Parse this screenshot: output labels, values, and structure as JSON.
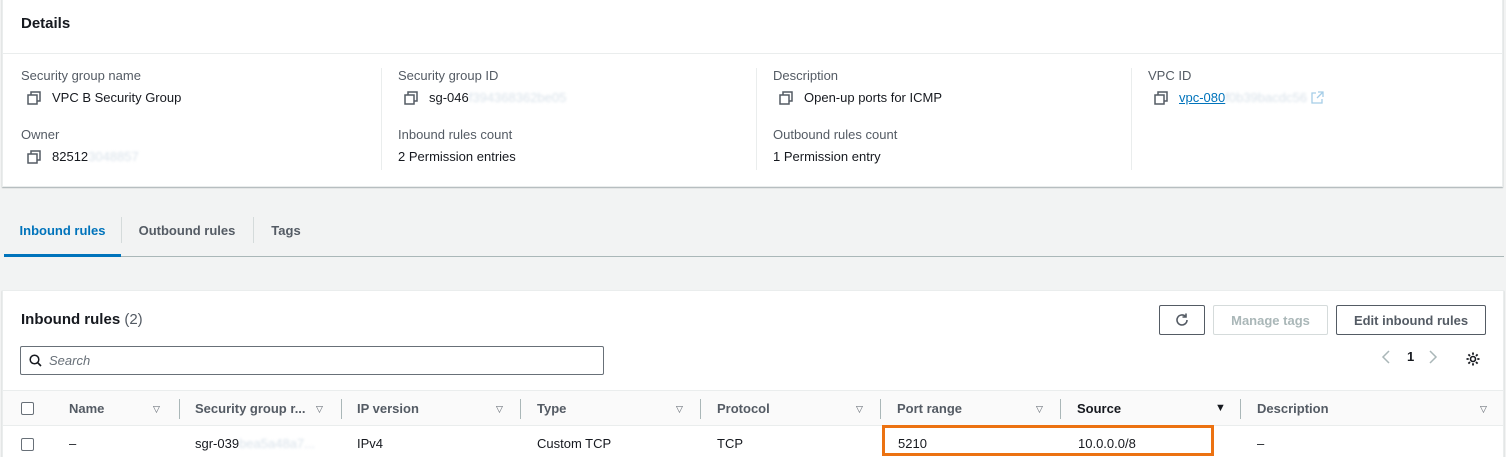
{
  "details": {
    "title": "Details",
    "security_group_name": {
      "label": "Security group name",
      "value": "VPC B Security Group"
    },
    "security_group_id": {
      "label": "Security group ID",
      "value": "sg-046",
      "redacted": "f394368362be05"
    },
    "description": {
      "label": "Description",
      "value": "Open-up ports for ICMP"
    },
    "vpc_id": {
      "label": "VPC ID",
      "value": "vpc-080",
      "redacted": "f0b39bacdc56"
    },
    "owner": {
      "label": "Owner",
      "value": "82512",
      "redacted": "3048857"
    },
    "inbound_rules_count": {
      "label": "Inbound rules count",
      "value": "2 Permission entries"
    },
    "outbound_rules_count": {
      "label": "Outbound rules count",
      "value": "1 Permission entry"
    }
  },
  "tabs": [
    {
      "label": "Inbound rules",
      "active": true
    },
    {
      "label": "Outbound rules",
      "active": false
    },
    {
      "label": "Tags",
      "active": false
    }
  ],
  "inbound_rules": {
    "title": "Inbound rules",
    "count": "(2)",
    "buttons": {
      "refresh": "refresh-icon",
      "manage_tags": "Manage tags",
      "edit": "Edit inbound rules"
    },
    "search_placeholder": "Search",
    "page": "1",
    "columns": [
      "Name",
      "Security group r...",
      "IP version",
      "Type",
      "Protocol",
      "Port range",
      "Source",
      "Description"
    ],
    "rows": [
      {
        "name": "–",
        "sgr_id": "sgr-039",
        "sgr_redacted": "bea5a48a7...",
        "ip_version": "IPv4",
        "type": "Custom TCP",
        "protocol": "TCP",
        "port_range": "5210",
        "source": "10.0.0.0/8",
        "description": "–"
      }
    ]
  },
  "colors": {
    "accent": "#0073bb",
    "highlight": "#ec7211",
    "border": "#eaeded"
  }
}
